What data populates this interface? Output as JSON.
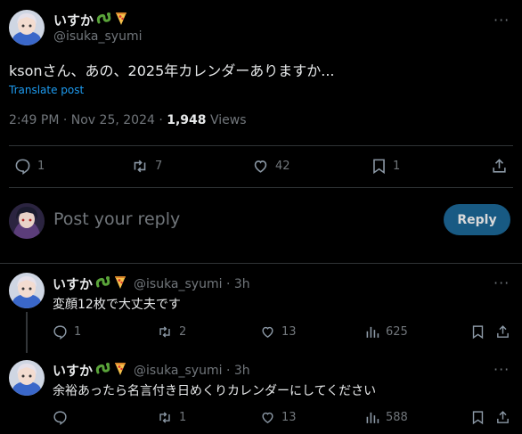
{
  "main_tweet": {
    "display_name": "いすか",
    "handle": "@isuka_syumi",
    "text": "ksonさん、あの、2025年カレンダーありますか...",
    "translate": "Translate post",
    "time": "2:49 PM · Nov 25, 2024",
    "separator": "·",
    "views_count": "1,948",
    "views_label": "Views",
    "actions": {
      "replies": "1",
      "reposts": "7",
      "likes": "42",
      "bookmarks": "1"
    }
  },
  "reply_box": {
    "placeholder": "Post your reply",
    "button": "Reply"
  },
  "replies": [
    {
      "display_name": "いすか",
      "handle": "@isuka_syumi · 3h",
      "text": "変顔12枚で大丈夫です",
      "actions": {
        "replies": "1",
        "reposts": "2",
        "likes": "13",
        "views": "625"
      }
    },
    {
      "display_name": "いすか",
      "handle": "@isuka_syumi · 3h",
      "text": "余裕あったら名言付き日めくりカレンダーにしてください",
      "actions": {
        "replies": "",
        "reposts": "1",
        "likes": "13",
        "views": "588"
      }
    }
  ],
  "colors": {
    "background": "#000000",
    "text": "#e7e9ea",
    "muted": "#71767b",
    "link": "#1d9bf0",
    "reply_button_bg": "#1d6a9b",
    "divider": "#2f3336"
  }
}
